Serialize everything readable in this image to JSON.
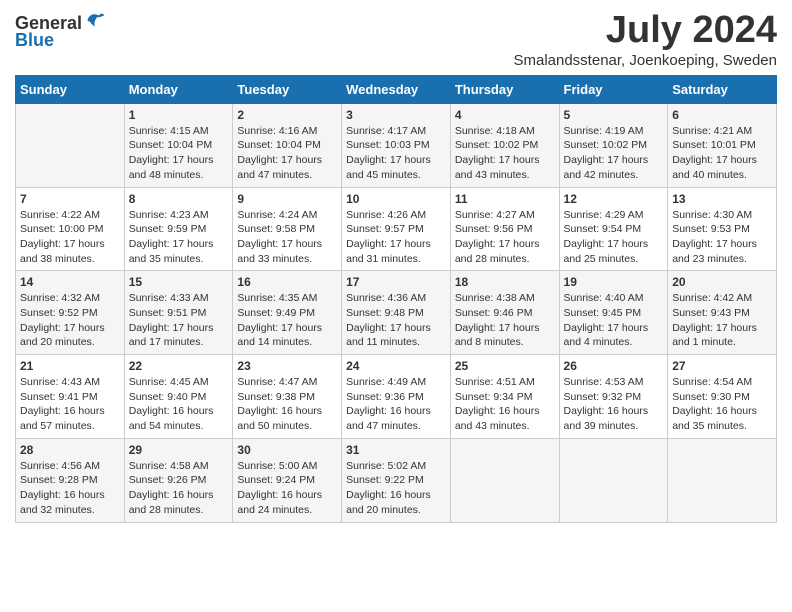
{
  "logo": {
    "text_general": "General",
    "text_blue": "Blue"
  },
  "title": "July 2024",
  "subtitle": "Smalandsstenar, Joenkoeping, Sweden",
  "days_header": [
    "Sunday",
    "Monday",
    "Tuesday",
    "Wednesday",
    "Thursday",
    "Friday",
    "Saturday"
  ],
  "weeks": [
    [
      {
        "day": "",
        "info": ""
      },
      {
        "day": "1",
        "info": "Sunrise: 4:15 AM\nSunset: 10:04 PM\nDaylight: 17 hours\nand 48 minutes."
      },
      {
        "day": "2",
        "info": "Sunrise: 4:16 AM\nSunset: 10:04 PM\nDaylight: 17 hours\nand 47 minutes."
      },
      {
        "day": "3",
        "info": "Sunrise: 4:17 AM\nSunset: 10:03 PM\nDaylight: 17 hours\nand 45 minutes."
      },
      {
        "day": "4",
        "info": "Sunrise: 4:18 AM\nSunset: 10:02 PM\nDaylight: 17 hours\nand 43 minutes."
      },
      {
        "day": "5",
        "info": "Sunrise: 4:19 AM\nSunset: 10:02 PM\nDaylight: 17 hours\nand 42 minutes."
      },
      {
        "day": "6",
        "info": "Sunrise: 4:21 AM\nSunset: 10:01 PM\nDaylight: 17 hours\nand 40 minutes."
      }
    ],
    [
      {
        "day": "7",
        "info": "Sunrise: 4:22 AM\nSunset: 10:00 PM\nDaylight: 17 hours\nand 38 minutes."
      },
      {
        "day": "8",
        "info": "Sunrise: 4:23 AM\nSunset: 9:59 PM\nDaylight: 17 hours\nand 35 minutes."
      },
      {
        "day": "9",
        "info": "Sunrise: 4:24 AM\nSunset: 9:58 PM\nDaylight: 17 hours\nand 33 minutes."
      },
      {
        "day": "10",
        "info": "Sunrise: 4:26 AM\nSunset: 9:57 PM\nDaylight: 17 hours\nand 31 minutes."
      },
      {
        "day": "11",
        "info": "Sunrise: 4:27 AM\nSunset: 9:56 PM\nDaylight: 17 hours\nand 28 minutes."
      },
      {
        "day": "12",
        "info": "Sunrise: 4:29 AM\nSunset: 9:54 PM\nDaylight: 17 hours\nand 25 minutes."
      },
      {
        "day": "13",
        "info": "Sunrise: 4:30 AM\nSunset: 9:53 PM\nDaylight: 17 hours\nand 23 minutes."
      }
    ],
    [
      {
        "day": "14",
        "info": "Sunrise: 4:32 AM\nSunset: 9:52 PM\nDaylight: 17 hours\nand 20 minutes."
      },
      {
        "day": "15",
        "info": "Sunrise: 4:33 AM\nSunset: 9:51 PM\nDaylight: 17 hours\nand 17 minutes."
      },
      {
        "day": "16",
        "info": "Sunrise: 4:35 AM\nSunset: 9:49 PM\nDaylight: 17 hours\nand 14 minutes."
      },
      {
        "day": "17",
        "info": "Sunrise: 4:36 AM\nSunset: 9:48 PM\nDaylight: 17 hours\nand 11 minutes."
      },
      {
        "day": "18",
        "info": "Sunrise: 4:38 AM\nSunset: 9:46 PM\nDaylight: 17 hours\nand 8 minutes."
      },
      {
        "day": "19",
        "info": "Sunrise: 4:40 AM\nSunset: 9:45 PM\nDaylight: 17 hours\nand 4 minutes."
      },
      {
        "day": "20",
        "info": "Sunrise: 4:42 AM\nSunset: 9:43 PM\nDaylight: 17 hours\nand 1 minute."
      }
    ],
    [
      {
        "day": "21",
        "info": "Sunrise: 4:43 AM\nSunset: 9:41 PM\nDaylight: 16 hours\nand 57 minutes."
      },
      {
        "day": "22",
        "info": "Sunrise: 4:45 AM\nSunset: 9:40 PM\nDaylight: 16 hours\nand 54 minutes."
      },
      {
        "day": "23",
        "info": "Sunrise: 4:47 AM\nSunset: 9:38 PM\nDaylight: 16 hours\nand 50 minutes."
      },
      {
        "day": "24",
        "info": "Sunrise: 4:49 AM\nSunset: 9:36 PM\nDaylight: 16 hours\nand 47 minutes."
      },
      {
        "day": "25",
        "info": "Sunrise: 4:51 AM\nSunset: 9:34 PM\nDaylight: 16 hours\nand 43 minutes."
      },
      {
        "day": "26",
        "info": "Sunrise: 4:53 AM\nSunset: 9:32 PM\nDaylight: 16 hours\nand 39 minutes."
      },
      {
        "day": "27",
        "info": "Sunrise: 4:54 AM\nSunset: 9:30 PM\nDaylight: 16 hours\nand 35 minutes."
      }
    ],
    [
      {
        "day": "28",
        "info": "Sunrise: 4:56 AM\nSunset: 9:28 PM\nDaylight: 16 hours\nand 32 minutes."
      },
      {
        "day": "29",
        "info": "Sunrise: 4:58 AM\nSunset: 9:26 PM\nDaylight: 16 hours\nand 28 minutes."
      },
      {
        "day": "30",
        "info": "Sunrise: 5:00 AM\nSunset: 9:24 PM\nDaylight: 16 hours\nand 24 minutes."
      },
      {
        "day": "31",
        "info": "Sunrise: 5:02 AM\nSunset: 9:22 PM\nDaylight: 16 hours\nand 20 minutes."
      },
      {
        "day": "",
        "info": ""
      },
      {
        "day": "",
        "info": ""
      },
      {
        "day": "",
        "info": ""
      }
    ]
  ]
}
